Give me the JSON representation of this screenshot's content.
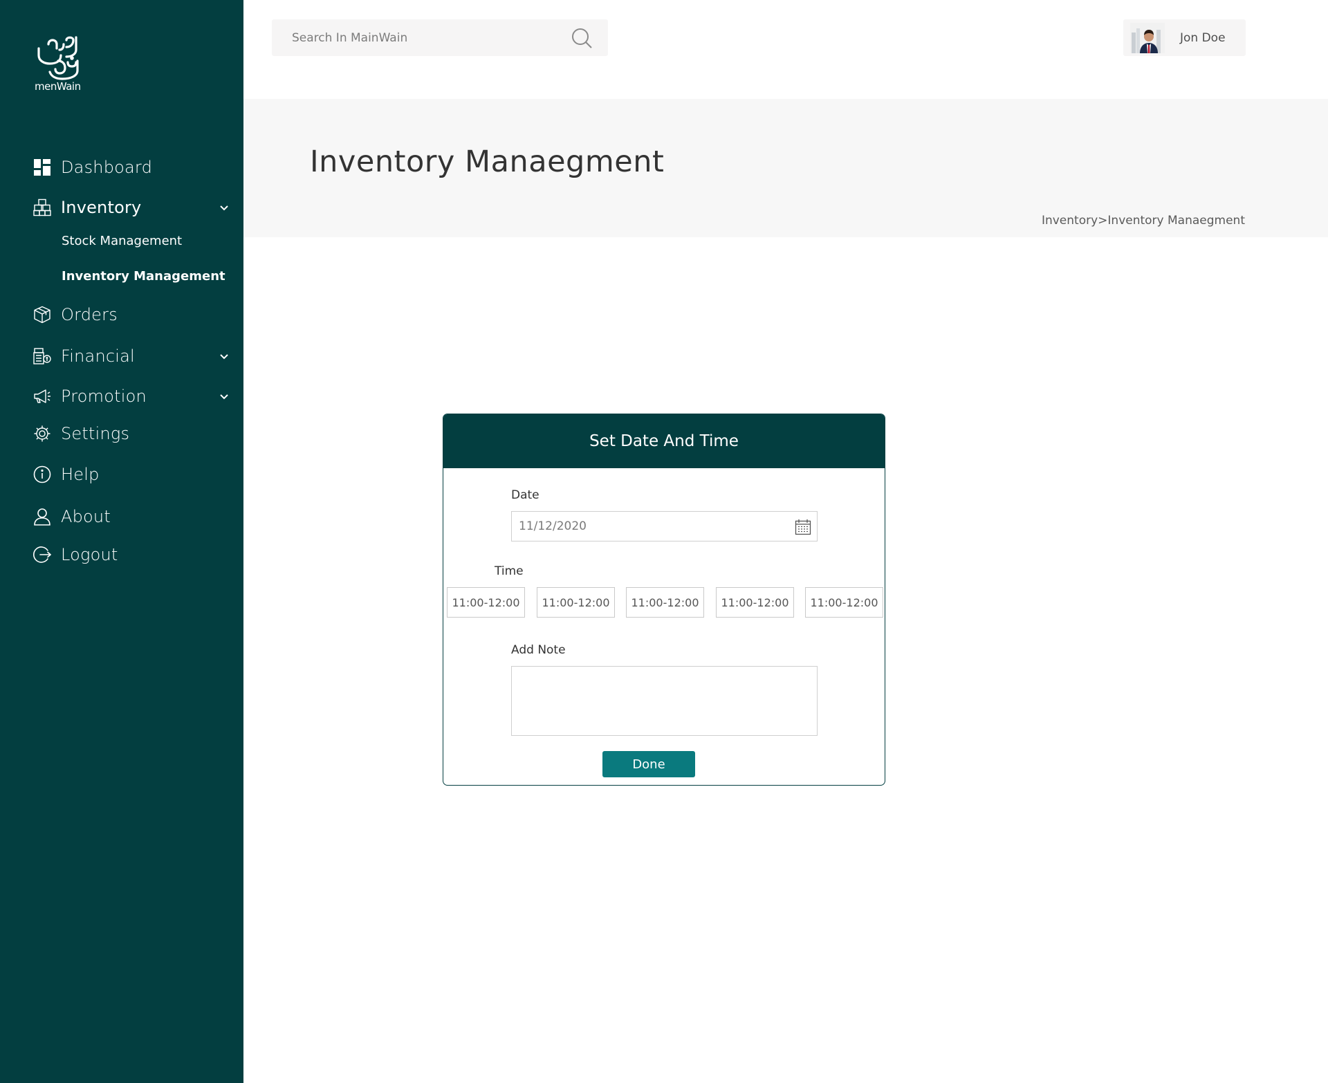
{
  "brand": {
    "logo_text": "menWain",
    "colors": {
      "sidebar": "#033e40",
      "accent": "#0a7a7e",
      "title_band": "#f7f7f7"
    }
  },
  "sidebar": {
    "items": [
      {
        "label": "Dashboard",
        "icon": "dashboard-icon"
      },
      {
        "label": "Inventory",
        "icon": "inventory-boxes-icon",
        "expanded": true
      },
      {
        "label": "Orders",
        "icon": "package-icon"
      },
      {
        "label": "Financial",
        "icon": "cash-register-icon"
      },
      {
        "label": "Promotion",
        "icon": "megaphone-icon"
      },
      {
        "label": "Settings",
        "icon": "gear-icon"
      },
      {
        "label": "Help",
        "icon": "info-icon"
      },
      {
        "label": "About",
        "icon": "user-icon"
      },
      {
        "label": "Logout",
        "icon": "logout-icon"
      }
    ],
    "inventory_sub": [
      {
        "label": "Stock Management"
      },
      {
        "label": "Inventory Management",
        "active": true
      }
    ]
  },
  "topbar": {
    "search_placeholder": "Search In MainWain",
    "user_name": "Jon Doe"
  },
  "page": {
    "title": "Inventory Manaegment",
    "breadcrumb": {
      "parent": "Inventory",
      "separator": ">",
      "current": "Inventory Manaegment"
    }
  },
  "modal": {
    "title": "Set Date And Time",
    "date_label": "Date",
    "date_value": "11/12/2020",
    "time_label": "Time",
    "time_slots": [
      "11:00-12:00",
      "11:00-12:00",
      "11:00-12:00",
      "11:00-12:00",
      "11:00-12:00"
    ],
    "note_label": "Add Note",
    "note_value": "",
    "done_label": "Done"
  }
}
